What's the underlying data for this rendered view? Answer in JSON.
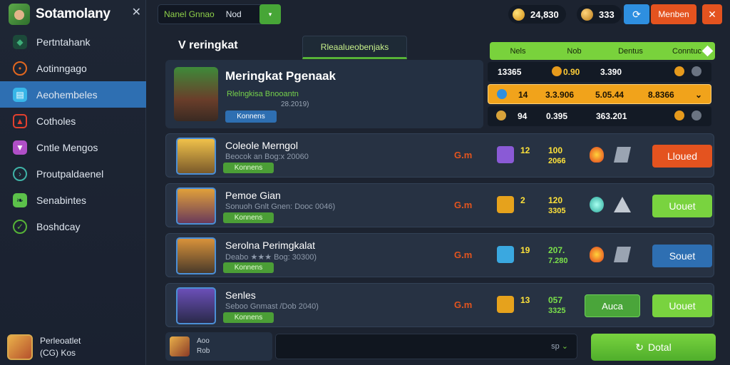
{
  "app": {
    "name": "Sotamolany",
    "close_glyph": "✕"
  },
  "sidebar": {
    "items": [
      {
        "label": "Pertntahank",
        "icon": "shield-icon",
        "color": "#3fae7a"
      },
      {
        "label": "Aotinngago",
        "icon": "target-icon",
        "color": "#e2671f"
      },
      {
        "label": "Aeohembeles",
        "icon": "chat-icon",
        "color": "#38b6e8",
        "active": true
      },
      {
        "label": "Cotholes",
        "icon": "flame-icon",
        "color": "#e2402e"
      },
      {
        "label": "Cntle Mengos",
        "icon": "trophy-icon",
        "color": "#b04fc7"
      },
      {
        "label": "Proutpaldaenel",
        "icon": "globe-icon",
        "color": "#3fb3a7"
      },
      {
        "label": "Senabintes",
        "icon": "leaf-icon",
        "color": "#5cc14a"
      },
      {
        "label": "Boshdcay",
        "icon": "check-circle-icon",
        "color": "#56b337"
      }
    ],
    "profile": {
      "line1": "Perleoatlet",
      "line2": "(CG) Kos"
    }
  },
  "topbar": {
    "search_label": "Nanel Gnnao",
    "search_value": "Nod",
    "search_btn": "▾",
    "coins": "24,830",
    "gems": "333",
    "menu_label": "Menben",
    "accent_blue": "#2e8fe0",
    "accent_orange": "#e4531f"
  },
  "main": {
    "title": "V reringkat",
    "active_tab": "Rleaalueobenjaks",
    "filters": [
      "Nels",
      "Nob",
      "Dentus",
      "Conntuc"
    ]
  },
  "featured": {
    "title": "Meringkat Pgenaak",
    "subtitle": "Rlelngkisa Bnooantn",
    "date": "28.2019)",
    "button": "Konnens"
  },
  "leaderboard": [
    {
      "a": "13365",
      "b": "0.90",
      "c": "3.390",
      "highlight": false
    },
    {
      "a": "14",
      "b": "3.3.906",
      "c": "5.05.44",
      "d": "8.8366",
      "highlight": true
    },
    {
      "a": "94",
      "b": "0.395",
      "c": "363.201",
      "highlight": false
    }
  ],
  "players": [
    {
      "name": "Coleole Merngol",
      "sub": "Beocok an  Bog:x 20060",
      "badge": "Konnens",
      "score": "G.m",
      "rank": "12",
      "rank_sub": "o",
      "s1": "100",
      "s2": "2066",
      "button": "Lloued",
      "button_color": "#e4531f",
      "avatar_color": "#d88b3a"
    },
    {
      "name": "Pemoe Gian",
      "sub": "Sonuoh Gnlt Gnen: Dooc 0046)",
      "badge": "Konnens",
      "score": "G.m",
      "rank": "2",
      "rank_sub": "o",
      "s1": "120",
      "s2": "3305",
      "button": "Uouet",
      "button_color": "#79d33f",
      "avatar_color": "#c76d3a"
    },
    {
      "name": "Serolna Perimgkalat",
      "sub": "Deabo  ★★★  Bog: 30300)",
      "badge": "Konnens",
      "score": "G.m",
      "rank": "19",
      "rank_sub": "o",
      "s1": "207.",
      "s2": "7.280",
      "button": "Souet",
      "button_color": "#2e6fb2",
      "avatar_color": "#b8743c"
    },
    {
      "name": "Senles",
      "sub": "Seboo Gnmast  /Dob 2040)",
      "badge": "Konnens",
      "score": "G.m",
      "rank": "13",
      "rank_sub": "o",
      "s1": "057",
      "s2": "3325",
      "button": "Uouet",
      "button_color": "#79d33f",
      "button2": "Auca",
      "avatar_color": "#6b4fb8"
    }
  ],
  "bottom": {
    "card_line1": "Aoo",
    "card_line2": "Rob",
    "input_hint": "sp",
    "button": "Dotal"
  }
}
